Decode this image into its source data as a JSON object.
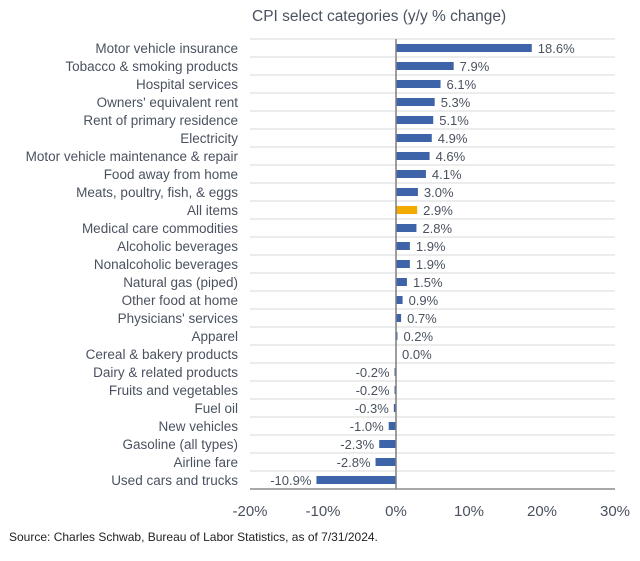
{
  "chart_data": {
    "type": "bar",
    "orientation": "horizontal",
    "title": "CPI select categories (y/y % change)",
    "xlabel": "",
    "ylabel": "",
    "xlim": [
      -20,
      30
    ],
    "x_ticks": [
      -20,
      -10,
      0,
      10,
      20,
      30
    ],
    "x_tick_labels": [
      "-20%",
      "-10%",
      "0%",
      "10%",
      "20%",
      "30%"
    ],
    "grid": "horizontal row separators",
    "legend": "none",
    "colors": {
      "default": "#3d64a8",
      "highlight": "#f2a900"
    },
    "highlight_category": "All items",
    "categories": [
      "Motor vehicle insurance",
      "Tobacco & smoking products",
      "Hospital services",
      "Owners' equivalent rent",
      "Rent of primary residence",
      "Electricity",
      "Motor vehicle maintenance & repair",
      "Food away from home",
      "Meats, poultry, fish, & eggs",
      "All items",
      "Medical care commodities",
      "Alcoholic beverages",
      "Nonalcoholic beverages",
      "Natural gas (piped)",
      "Other food at home",
      "Physicians' services",
      "Apparel",
      "Cereal & bakery products",
      "Dairy & related products",
      "Fruits and vegetables",
      "Fuel oil",
      "New vehicles",
      "Gasoline (all types)",
      "Airline fare",
      "Used cars and trucks"
    ],
    "values": [
      18.6,
      7.9,
      6.1,
      5.3,
      5.1,
      4.9,
      4.6,
      4.1,
      3.0,
      2.9,
      2.8,
      1.9,
      1.9,
      1.5,
      0.9,
      0.7,
      0.2,
      0.0,
      -0.2,
      -0.2,
      -0.3,
      -1.0,
      -2.3,
      -2.8,
      -10.9
    ],
    "value_labels": [
      "18.6%",
      "7.9%",
      "6.1%",
      "5.3%",
      "5.1%",
      "4.9%",
      "4.6%",
      "4.1%",
      "3.0%",
      "2.9%",
      "2.8%",
      "1.9%",
      "1.9%",
      "1.5%",
      "0.9%",
      "0.7%",
      "0.2%",
      "0.0%",
      "-0.2%",
      "-0.2%",
      "-0.3%",
      "-1.0%",
      "-2.3%",
      "-2.8%",
      "-10.9%"
    ]
  },
  "footer": {
    "source": "Source: Charles Schwab, Bureau of Labor Statistics, as of 7/31/2024."
  }
}
